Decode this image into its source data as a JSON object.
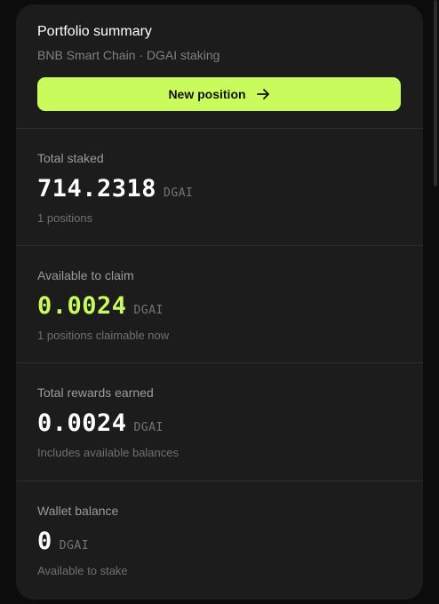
{
  "summary": {
    "title": "Portfolio summary",
    "subtitle": "BNB Smart Chain · DGAI staking",
    "new_position_label": "New position",
    "new_position_icon": "arrow-right-icon"
  },
  "stats": {
    "total_staked": {
      "label": "Total staked",
      "value": "714.2318",
      "unit": "DGAI",
      "note": "1 positions"
    },
    "available_to_claim": {
      "label": "Available to claim",
      "value": "0.0024",
      "unit": "DGAI",
      "note": "1 positions claimable now"
    },
    "total_rewards": {
      "label": "Total rewards earned",
      "value": "0.0024",
      "unit": "DGAI",
      "note": "Includes available balances"
    },
    "wallet_balance": {
      "label": "Wallet balance",
      "value": "0",
      "unit": "DGAI",
      "note": "Available to stake"
    }
  },
  "colors": {
    "accent": "#c8fb5b",
    "card_background": "#1b1c1b",
    "page_background": "#0b0c0b"
  }
}
